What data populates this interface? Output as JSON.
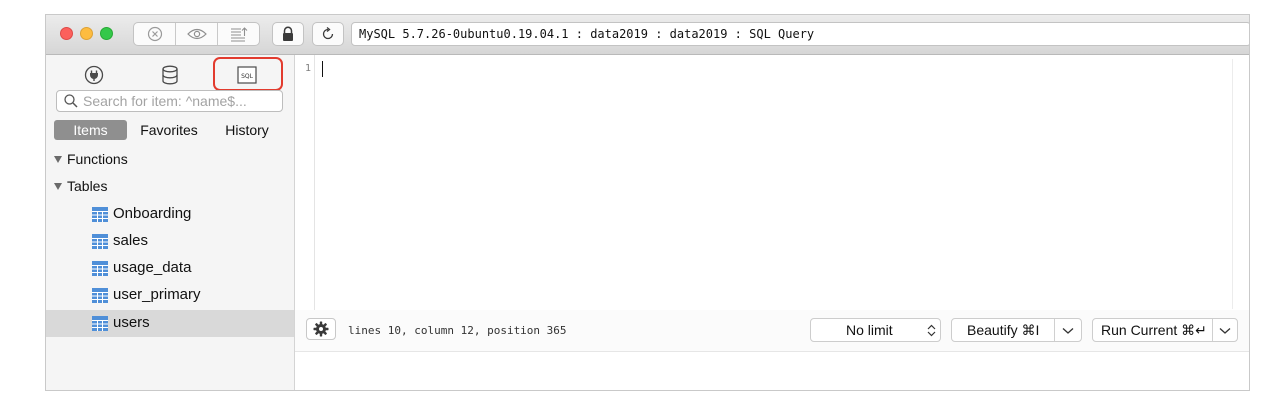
{
  "window": {
    "address": "MySQL 5.7.26-0ubuntu0.19.04.1 : data2019 : data2019 : SQL Query"
  },
  "toolbar": {
    "icons": [
      "close-circle-icon",
      "eye-icon",
      "list-arrow-icon",
      "lock-icon",
      "refresh-icon"
    ]
  },
  "sidebar": {
    "nav_icons": [
      "plug-icon",
      "database-icon",
      "sql-file-icon"
    ],
    "sql_icon_text": "SQL",
    "search_placeholder": "Search for item: ^name$...",
    "tabs": [
      {
        "label": "Items",
        "active": true
      },
      {
        "label": "Favorites",
        "active": false
      },
      {
        "label": "History",
        "active": false
      }
    ],
    "sections": {
      "functions": "Functions",
      "tables": "Tables"
    },
    "tables": [
      {
        "label": "Onboarding",
        "selected": false
      },
      {
        "label": "sales",
        "selected": false
      },
      {
        "label": "usage_data",
        "selected": false
      },
      {
        "label": "user_primary",
        "selected": false
      },
      {
        "label": "users",
        "selected": true
      }
    ]
  },
  "editor": {
    "line_number": "1"
  },
  "statusbar": {
    "cursor_position": "lines 10, column 12, position 365",
    "limit": "No limit",
    "beautify": "Beautify ⌘I",
    "run": "Run Current ⌘↵"
  },
  "colors": {
    "highlight": "#e23b2e",
    "table_icon": "#4f8fd8",
    "selected_row": "#d9d9d9"
  }
}
